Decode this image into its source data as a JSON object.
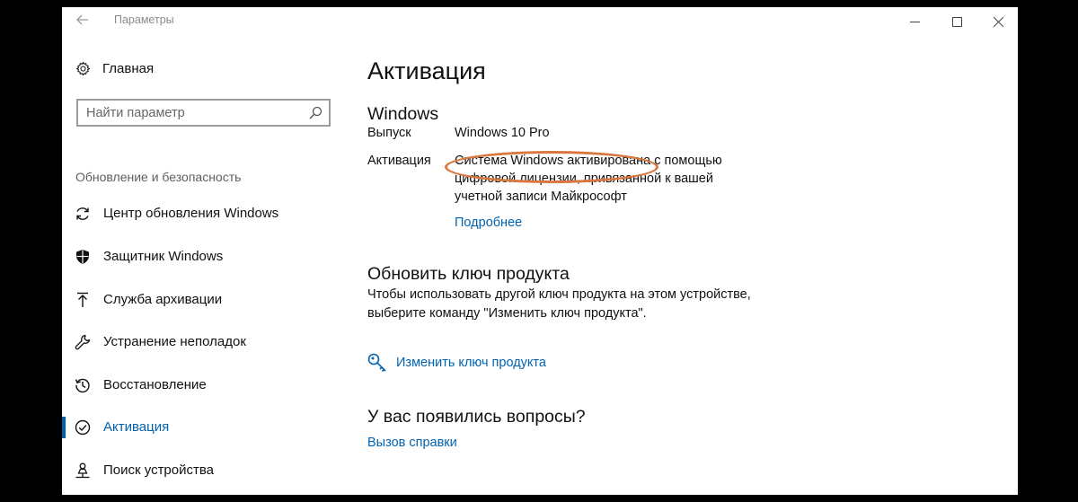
{
  "window": {
    "app_title": "Параметры",
    "back_icon": "back-arrow-icon"
  },
  "sidebar": {
    "home_label": "Главная",
    "search": {
      "placeholder": "Найти параметр"
    },
    "section_label": "Обновление и безопасность",
    "items": [
      {
        "label": "Центр обновления Windows",
        "icon": "refresh-icon"
      },
      {
        "label": "Защитник Windows",
        "icon": "shield-icon"
      },
      {
        "label": "Служба архивации",
        "icon": "upload-arrow-icon"
      },
      {
        "label": "Устранение неполадок",
        "icon": "wrench-icon"
      },
      {
        "label": "Восстановление",
        "icon": "history-icon"
      },
      {
        "label": "Активация",
        "icon": "check-circle-icon",
        "active": true
      },
      {
        "label": "Поиск устройства",
        "icon": "person-pin-icon"
      }
    ],
    "accent_color": "#0063b1"
  },
  "main": {
    "title": "Активация",
    "windows_section": {
      "heading": "Windows",
      "edition_label": "Выпуск",
      "edition_value": "Windows 10 Pro",
      "activation_label": "Активация",
      "activation_value_line1": "Система Windows активирована с помощью",
      "activation_value_line2": "цифровой лицензии, привязанной к вашей",
      "activation_value_line3": "учетной записи Майкрософт",
      "details_link": "Подробнее",
      "highlight_color": "#d9783e"
    },
    "update_key_section": {
      "heading": "Обновить ключ продукта",
      "description_line1": "Чтобы использовать другой ключ продукта на этом устройстве,",
      "description_line2": "выберите команду \"Изменить ключ продукта\".",
      "change_key_link": "Изменить ключ продукта"
    },
    "questions_section": {
      "heading": "У вас появились вопросы?",
      "help_link": "Вызов справки"
    }
  }
}
